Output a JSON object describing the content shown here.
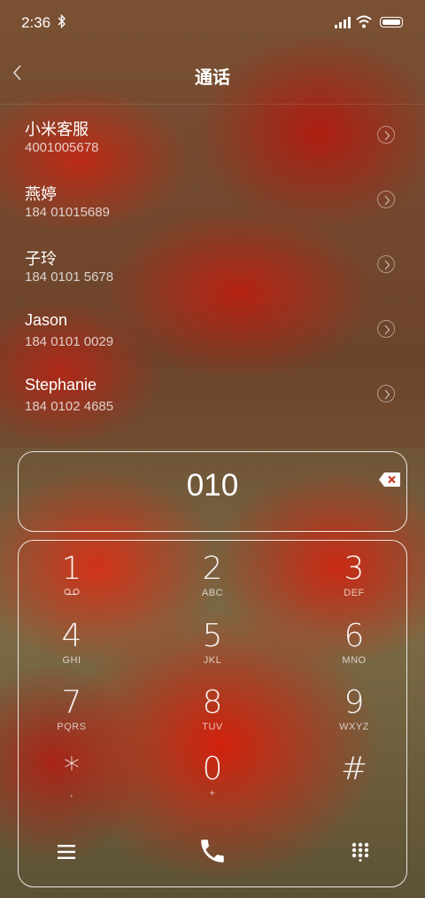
{
  "status": {
    "time": "2:36"
  },
  "header": {
    "title": "通话"
  },
  "contacts": [
    {
      "name": "小米客服",
      "number": "4001005678"
    },
    {
      "name": "燕婷",
      "number": "184 01015689"
    },
    {
      "name": "子玲",
      "number": "184 0101 5678"
    },
    {
      "name": "Jason",
      "number": "184 0101 0029"
    },
    {
      "name": "Stephanie",
      "number": "184 0102 4685"
    }
  ],
  "dialer": {
    "number": "010"
  },
  "keypad": [
    {
      "digit": "1",
      "letters": ""
    },
    {
      "digit": "2",
      "letters": "ABC"
    },
    {
      "digit": "3",
      "letters": "DEF"
    },
    {
      "digit": "4",
      "letters": "GHI"
    },
    {
      "digit": "5",
      "letters": "JKL"
    },
    {
      "digit": "6",
      "letters": "MNO"
    },
    {
      "digit": "7",
      "letters": "PQRS"
    },
    {
      "digit": "8",
      "letters": "TUV"
    },
    {
      "digit": "9",
      "letters": "WXYZ"
    },
    {
      "digit": "*",
      "letters": ","
    },
    {
      "digit": "0",
      "letters": "+"
    },
    {
      "digit": "#",
      "letters": ""
    }
  ],
  "icons": {
    "back": "chevron-left-icon",
    "backspace": "backspace-icon",
    "menu": "menu-icon",
    "call": "phone-icon",
    "dialpad": "dialpad-icon",
    "voicemail": "voicemail-icon"
  }
}
